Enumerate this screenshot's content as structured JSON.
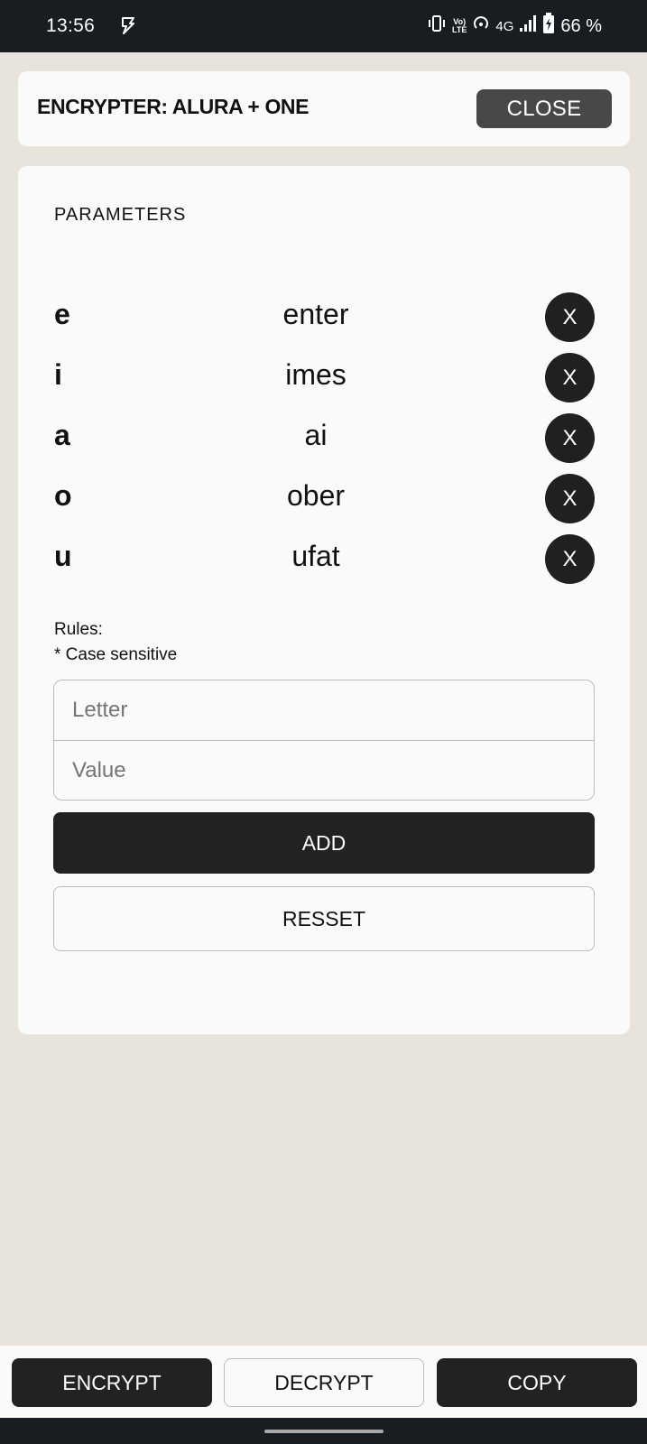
{
  "status_bar": {
    "time": "13:56",
    "network": "4G",
    "volte_top": "Vo)",
    "volte_bottom": "LTE",
    "battery": "66 %"
  },
  "header": {
    "title": "ENCRYPTER: ALURA + ONE",
    "close_label": "CLOSE"
  },
  "parameters": {
    "title": "PARAMETERS",
    "rules": [
      {
        "letter": "e",
        "value": "enter",
        "delete_label": "X"
      },
      {
        "letter": "i",
        "value": "imes",
        "delete_label": "X"
      },
      {
        "letter": "a",
        "value": "ai",
        "delete_label": "X"
      },
      {
        "letter": "o",
        "value": "ober",
        "delete_label": "X"
      },
      {
        "letter": "u",
        "value": "ufat",
        "delete_label": "X"
      }
    ],
    "rules_heading": "Rules:",
    "rules_note": "* Case sensitive",
    "letter_placeholder": "Letter",
    "value_placeholder": "Value",
    "add_label": "ADD",
    "reset_label": "RESSET"
  },
  "actions": {
    "encrypt_label": "ENCRYPT",
    "decrypt_label": "DECRYPT",
    "copy_label": "COPY"
  }
}
